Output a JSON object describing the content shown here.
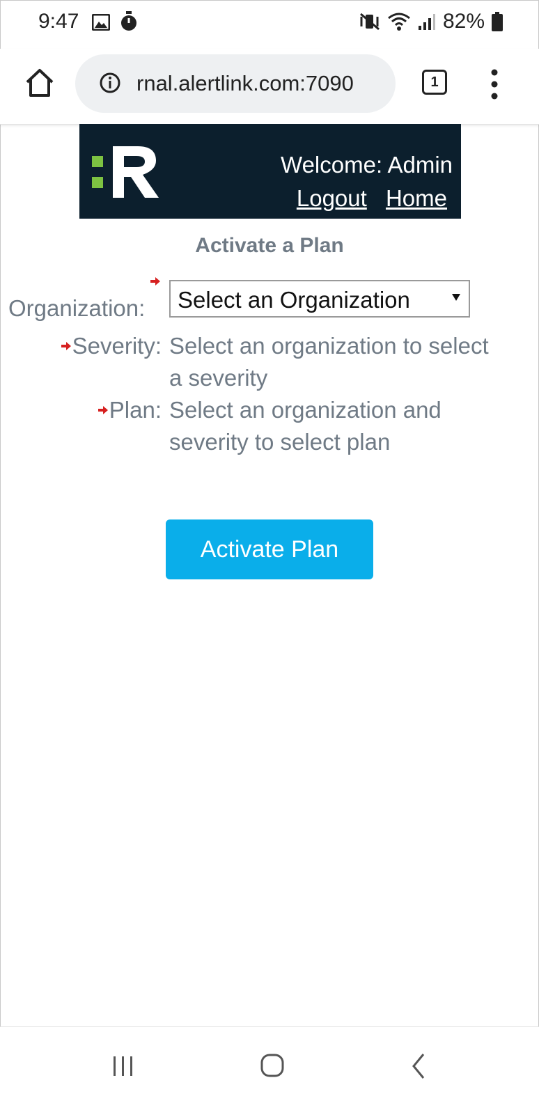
{
  "status_bar": {
    "time": "9:47",
    "battery": "82%",
    "left_icons": [
      "gallery-icon",
      "timer-icon"
    ],
    "right_icons": [
      "vibrate-mute-icon",
      "wifi-icon",
      "signal-icon",
      "battery-icon"
    ]
  },
  "browser": {
    "url": "rnal.alertlink.com:7090",
    "tab_count": "1"
  },
  "header": {
    "welcome": "Welcome: Admin",
    "logout_label": "Logout",
    "home_label": "Home",
    "brand_color": "#0c1f2d",
    "logo_accent": "#7dc242"
  },
  "form": {
    "title": "Activate a Plan",
    "organization_label": "Organization:",
    "organization_selected": "Select an Organization",
    "severity_label": "Severity:",
    "severity_text": "Select an organization to select a severity",
    "plan_label": "Plan:",
    "plan_text": "Select an organization and severity to select plan",
    "submit_label": "Activate Plan",
    "button_color": "#0aaeea",
    "required_marker_color": "#d62020"
  }
}
